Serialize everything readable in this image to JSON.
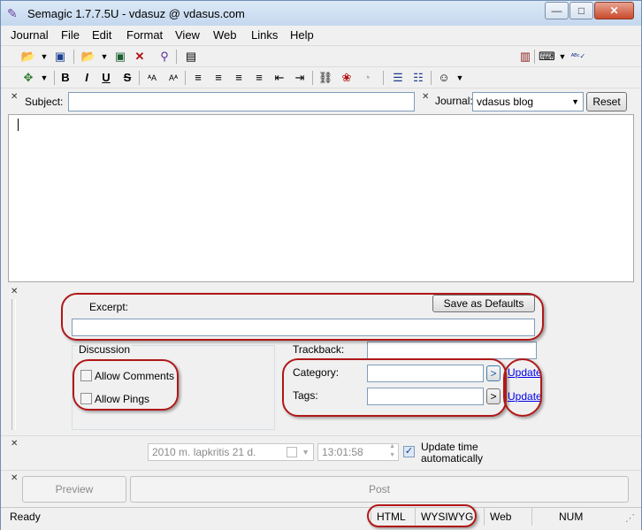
{
  "window": {
    "title": "Semagic 1.7.7.5U - vdasuz @ vdasus.com"
  },
  "menu": [
    "Journal",
    "File",
    "Edit",
    "Format",
    "View",
    "Web",
    "Links",
    "Help"
  ],
  "subject": {
    "label": "Subject:",
    "value": ""
  },
  "journal": {
    "label": "Journal:",
    "selected": "vdasus blog",
    "reset_label": "Reset"
  },
  "excerpt": {
    "label": "Excerpt:",
    "save_defaults_label": "Save as Defaults",
    "value": ""
  },
  "discussion": {
    "label": "Discussion",
    "allow_comments": "Allow Comments",
    "allow_pings": "Allow Pings"
  },
  "trackback": {
    "label": "Trackback:",
    "value": ""
  },
  "category": {
    "label": "Category:",
    "value": "",
    "update_label": "Update"
  },
  "tags": {
    "label": "Tags:",
    "value": "",
    "update_label": "Update"
  },
  "expand_symbol": ">",
  "datetime": {
    "date": "2010 m. lapkritis 21 d.",
    "time": "13:01:58",
    "update_auto_label": "Update time automatically",
    "update_auto_checked": true
  },
  "actions": {
    "preview_label": "Preview",
    "post_label": "Post"
  },
  "status": {
    "ready": "Ready",
    "html": "HTML",
    "wysiwyg": "WYSIWYG",
    "web": "Web",
    "num": "NUM"
  },
  "format_labels": {
    "bold": "B",
    "italic": "I",
    "underline": "U",
    "strike": "S"
  }
}
